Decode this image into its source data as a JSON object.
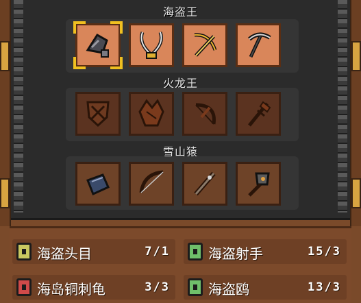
{
  "bosses": [
    {
      "title": "海盗王",
      "state": "unlocked",
      "items": [
        "anchor-weapon-icon",
        "twin-swords-icon",
        "golden-crossbow-icon",
        "pickaxe-icon"
      ]
    },
    {
      "title": "火龙王",
      "state": "locked",
      "items": [
        "shield-icon",
        "dragon-armor-icon",
        "dragon-bow-icon",
        "fire-staff-icon"
      ]
    },
    {
      "title": "雪山猿",
      "state": "gray",
      "items": [
        "ice-book-icon",
        "long-bow-icon",
        "spiked-club-icon",
        "war-hammer-icon"
      ]
    }
  ],
  "monsters": [
    {
      "name": "海盗头目",
      "count": "7/1",
      "book_color": "#c8c860"
    },
    {
      "name": "海盗射手",
      "count": "15/3",
      "book_color": "#6fbf6a"
    },
    {
      "name": "海岛铜刺龟",
      "count": "3/3",
      "book_color": "#d04a4a"
    },
    {
      "name": "海盗鸥",
      "count": "13/3",
      "book_color": "#6fbf6a"
    }
  ],
  "colors": {
    "selection": "#f0c020",
    "panel": "#2b2b2b",
    "wood": "#7c4a2b"
  }
}
